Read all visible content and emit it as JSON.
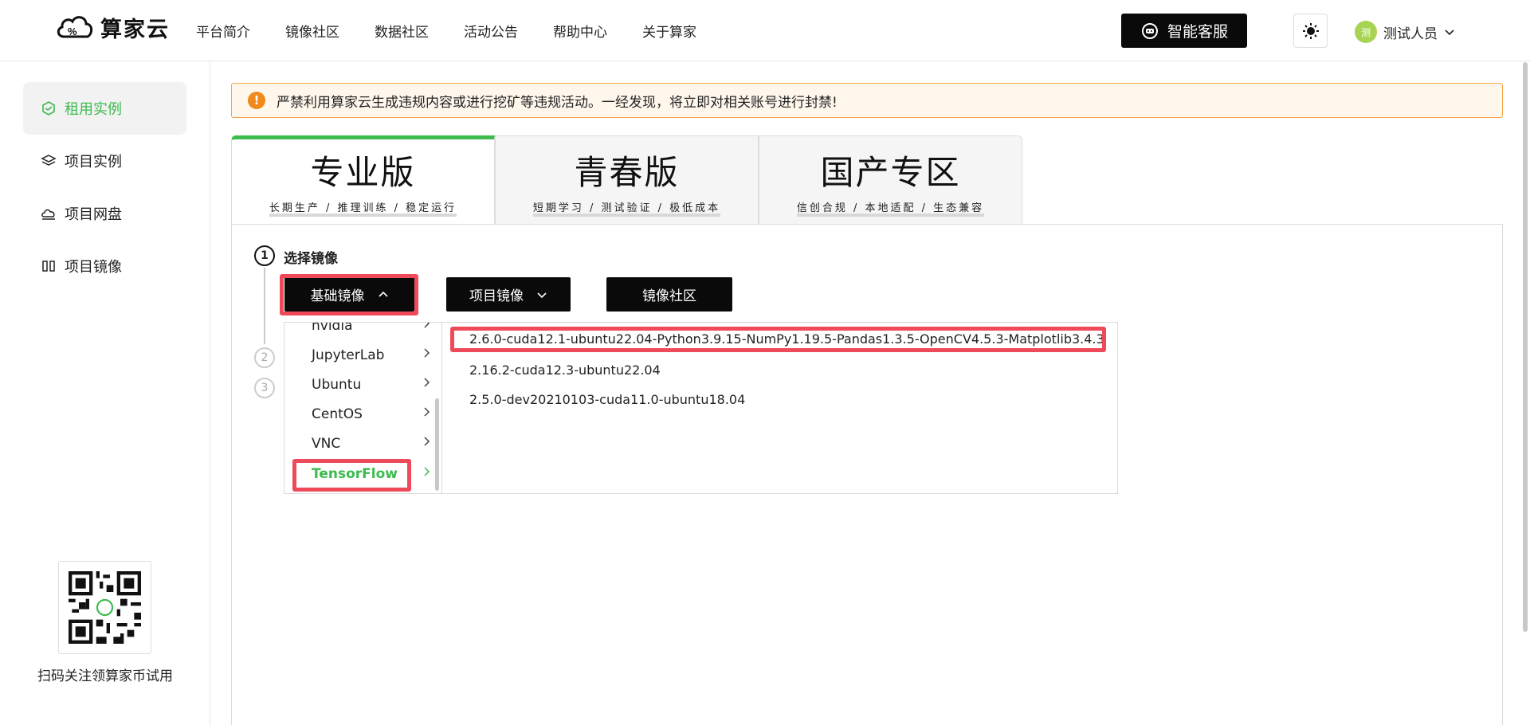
{
  "header": {
    "logo_text": "算家云",
    "nav": [
      "平台简介",
      "镜像社区",
      "数据社区",
      "活动公告",
      "帮助中心",
      "关于算家"
    ],
    "service_button": "智能客服",
    "user": {
      "avatar_text": "测",
      "name": "测试人员"
    }
  },
  "sidebar": {
    "items": [
      {
        "label": "租用实例",
        "active": true
      },
      {
        "label": "项目实例",
        "active": false
      },
      {
        "label": "项目网盘",
        "active": false
      },
      {
        "label": "项目镜像",
        "active": false
      }
    ],
    "qr_caption": "扫码关注领算家币试用"
  },
  "alert": {
    "icon_text": "!",
    "text": "严禁利用算家云生成违规内容或进行挖矿等违规活动。一经发现，将立即对相关账号进行封禁!"
  },
  "tabs": [
    {
      "title": "专业版",
      "subtitle": "长期生产 / 推理训练 / 稳定运行",
      "active": true
    },
    {
      "title": "青春版",
      "subtitle": "短期学习 / 测试验证 / 极低成本",
      "active": false
    },
    {
      "title": "国产专区",
      "subtitle": "信创合规 / 本地适配 / 生态兼容",
      "active": false
    }
  ],
  "steps": {
    "s1": "1",
    "s1_title": "选择镜像",
    "s2": "2",
    "s3": "3"
  },
  "image_tabs": {
    "basic": "基础镜像",
    "project": "项目镜像",
    "community": "镜像社区"
  },
  "categories": [
    "nvidia",
    "JupyterLab",
    "Ubuntu",
    "CentOS",
    "VNC",
    "TensorFlow"
  ],
  "selected_category": "TensorFlow",
  "versions": [
    "2.6.0-cuda12.1-ubuntu22.04-Python3.9.15-NumPy1.19.5-Pandas1.3.5-OpenCV4.5.3-Matplotlib3.4.3",
    "2.16.2-cuda12.3-ubuntu22.04",
    "2.5.0-dev20210103-cuda11.0-ubuntu18.04"
  ],
  "colors": {
    "accent": "#3dbb4f",
    "highlight": "#ef4a5a",
    "warning": "#f08a1c"
  }
}
